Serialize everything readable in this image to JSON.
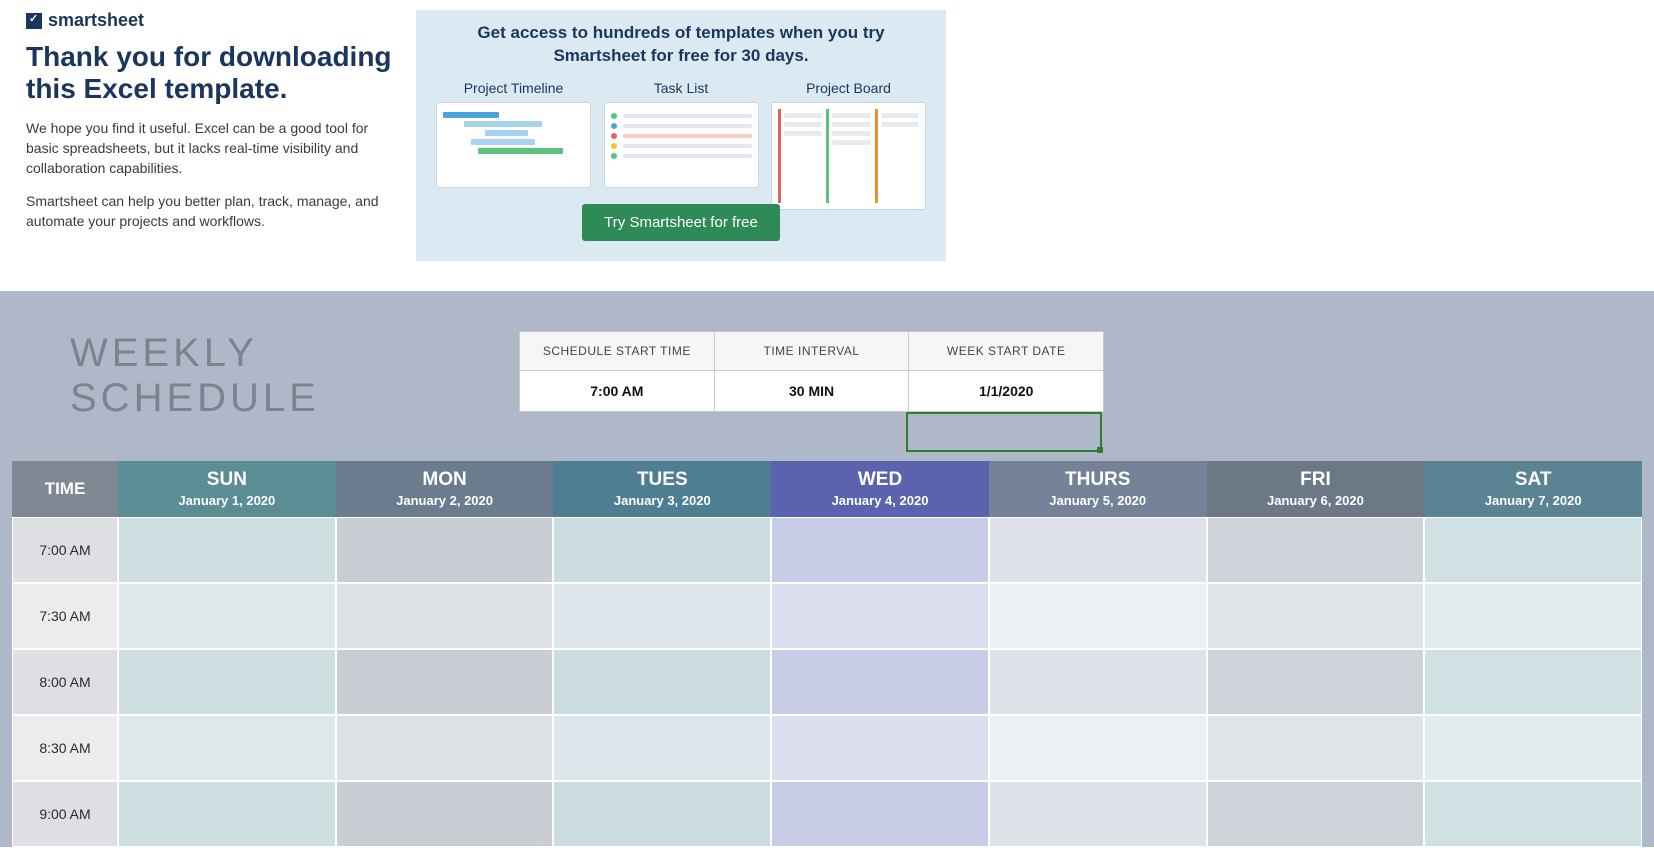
{
  "brand": "smartsheet",
  "thanks": "Thank you for downloading this Excel template.",
  "para1": "We hope you find it useful. Excel can be a good tool for basic spreadsheets, but it lacks real-time visibility and collaboration capabilities.",
  "para2": "Smartsheet can help you better plan, track, manage, and automate your projects and workflows.",
  "promo_headline": "Get access to hundreds of templates when you try Smartsheet for free for 30 days.",
  "template_cards": [
    "Project Timeline",
    "Task List",
    "Project Board"
  ],
  "cta_label": "Try Smartsheet for free",
  "schedule_title": "WEEKLY SCHEDULE",
  "settings": {
    "headers": [
      "SCHEDULE START TIME",
      "TIME INTERVAL",
      "WEEK START DATE"
    ],
    "values": [
      "7:00 AM",
      "30 MIN",
      "1/1/2020"
    ]
  },
  "time_header": "TIME",
  "time_slots": [
    "7:00 AM",
    "7:30 AM",
    "8:00 AM",
    "8:30 AM",
    "9:00 AM"
  ],
  "days": [
    {
      "dow": "SUN",
      "date": "January 1, 2020",
      "cls": "c-sun"
    },
    {
      "dow": "MON",
      "date": "January 2, 2020",
      "cls": "c-mon"
    },
    {
      "dow": "TUES",
      "date": "January 3, 2020",
      "cls": "c-tue"
    },
    {
      "dow": "WED",
      "date": "January 4, 2020",
      "cls": "c-wed"
    },
    {
      "dow": "THURS",
      "date": "January 5, 2020",
      "cls": "c-thu"
    },
    {
      "dow": "FRI",
      "date": "January 6, 2020",
      "cls": "c-fri"
    },
    {
      "dow": "SAT",
      "date": "January 7, 2020",
      "cls": "c-sat"
    }
  ]
}
